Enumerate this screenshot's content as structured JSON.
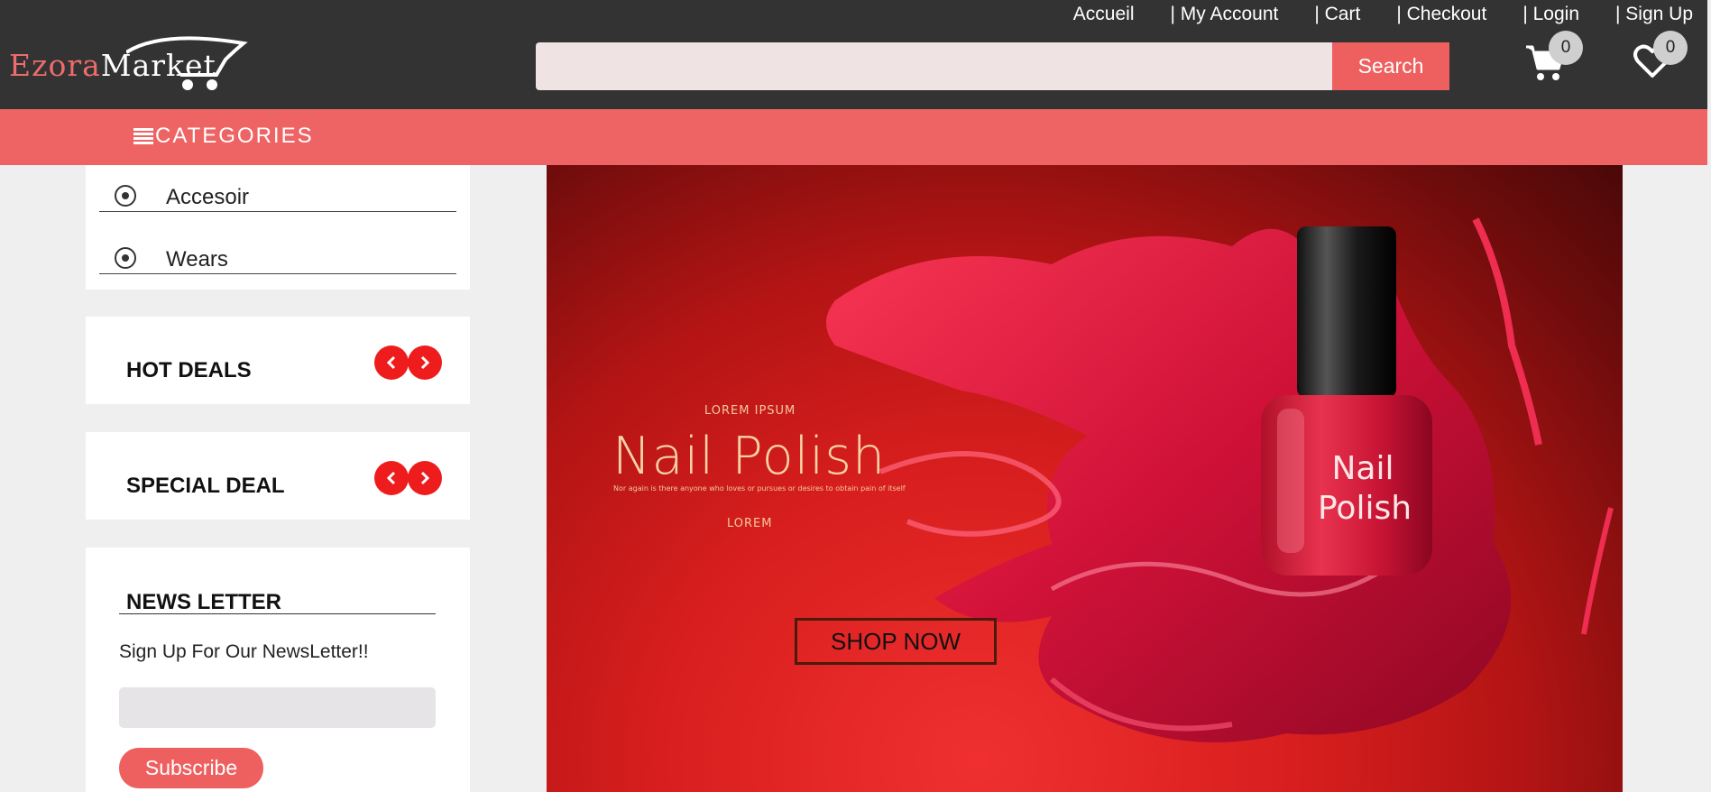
{
  "header": {
    "logo_part1": "Ezora",
    "logo_part2": "Market",
    "nav": [
      "Accueil",
      "| My Account",
      "| Cart",
      "| Checkout",
      "| Login",
      "| Sign Up"
    ],
    "search_placeholder": "",
    "search_button": "Search",
    "cart_count": "0",
    "wishlist_count": "0"
  },
  "categories_bar": {
    "label": "CATEGORIES"
  },
  "sidebar": {
    "categories": [
      "Accesoir",
      "Wears"
    ],
    "hot_deals_title": "HOT DEALS",
    "special_deal_title": "SPECIAL DEAL",
    "newsletter": {
      "title": "NEWS LETTER",
      "text": "Sign Up For Our NewsLetter!!",
      "input_placeholder": "",
      "button": "Subscribe"
    }
  },
  "banner": {
    "kicker": "LOREM IPSUM",
    "title": "Nail Polish",
    "description": "Nor again is there anyone who loves or pursues or desires to obtain pain of itself",
    "sub": "LOREM",
    "cta": "SHOP NOW",
    "bottle_label": "Nail Polish"
  },
  "colors": {
    "header_bg": "#333333",
    "accent": "#ee6363",
    "arrow_red": "#ee1c1c"
  }
}
